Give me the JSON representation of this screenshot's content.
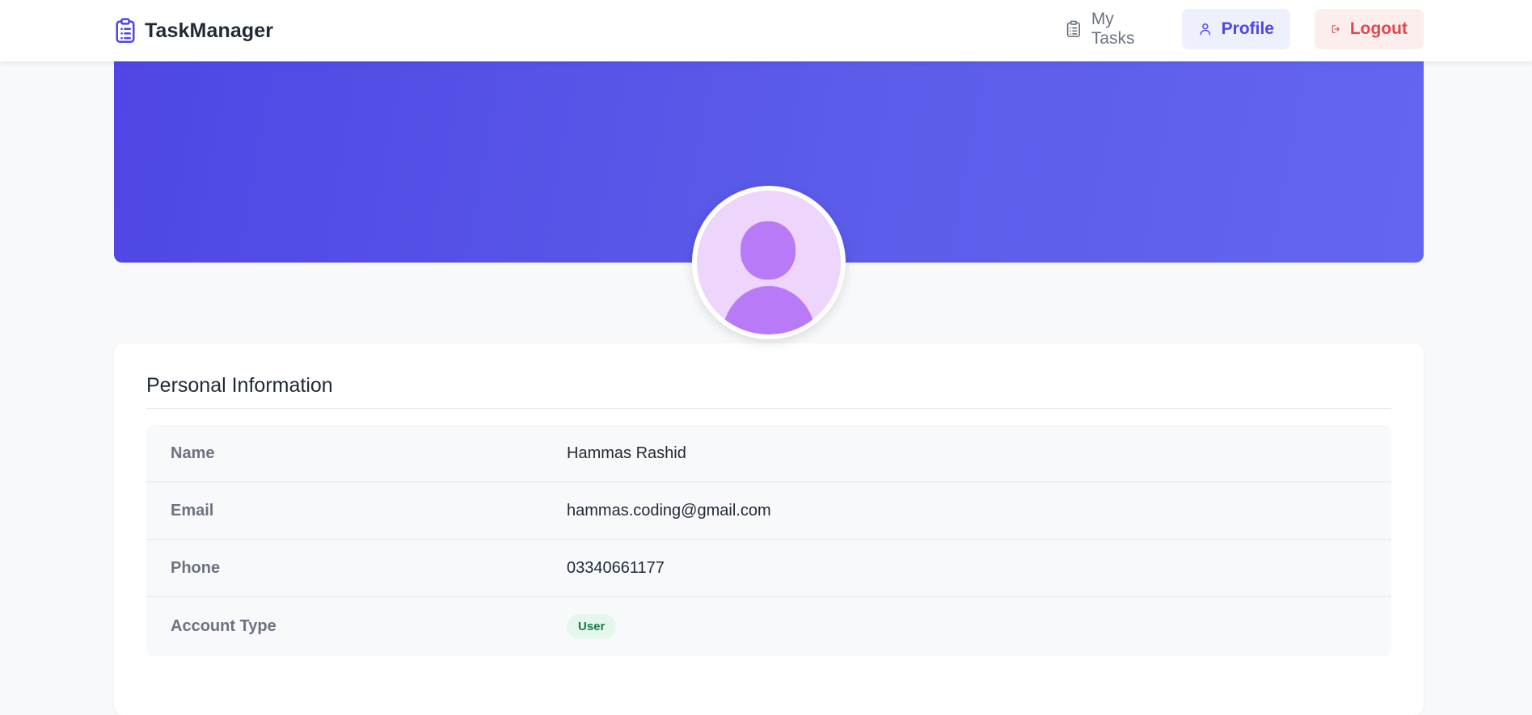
{
  "app": {
    "name": "TaskManager",
    "brand_icon": "clipboard-icon",
    "accent_color": "#4f46e5"
  },
  "nav": {
    "my_tasks": {
      "label": "My Tasks",
      "icon": "clipboard-icon"
    },
    "profile": {
      "label": "Profile",
      "icon": "user-icon",
      "active": true
    },
    "logout": {
      "label": "Logout",
      "icon": "logout-icon",
      "color": "#e04848"
    }
  },
  "profile": {
    "avatar_icon": "user-avatar-icon",
    "section_title": "Personal Information",
    "fields": [
      {
        "label": "Name",
        "value": "Hammas Rashid"
      },
      {
        "label": "Email",
        "value": "hammas.coding@gmail.com"
      },
      {
        "label": "Phone",
        "value": "03340661177"
      },
      {
        "label": "Account Type",
        "value": "User",
        "badge_color": "#177a44"
      }
    ]
  }
}
